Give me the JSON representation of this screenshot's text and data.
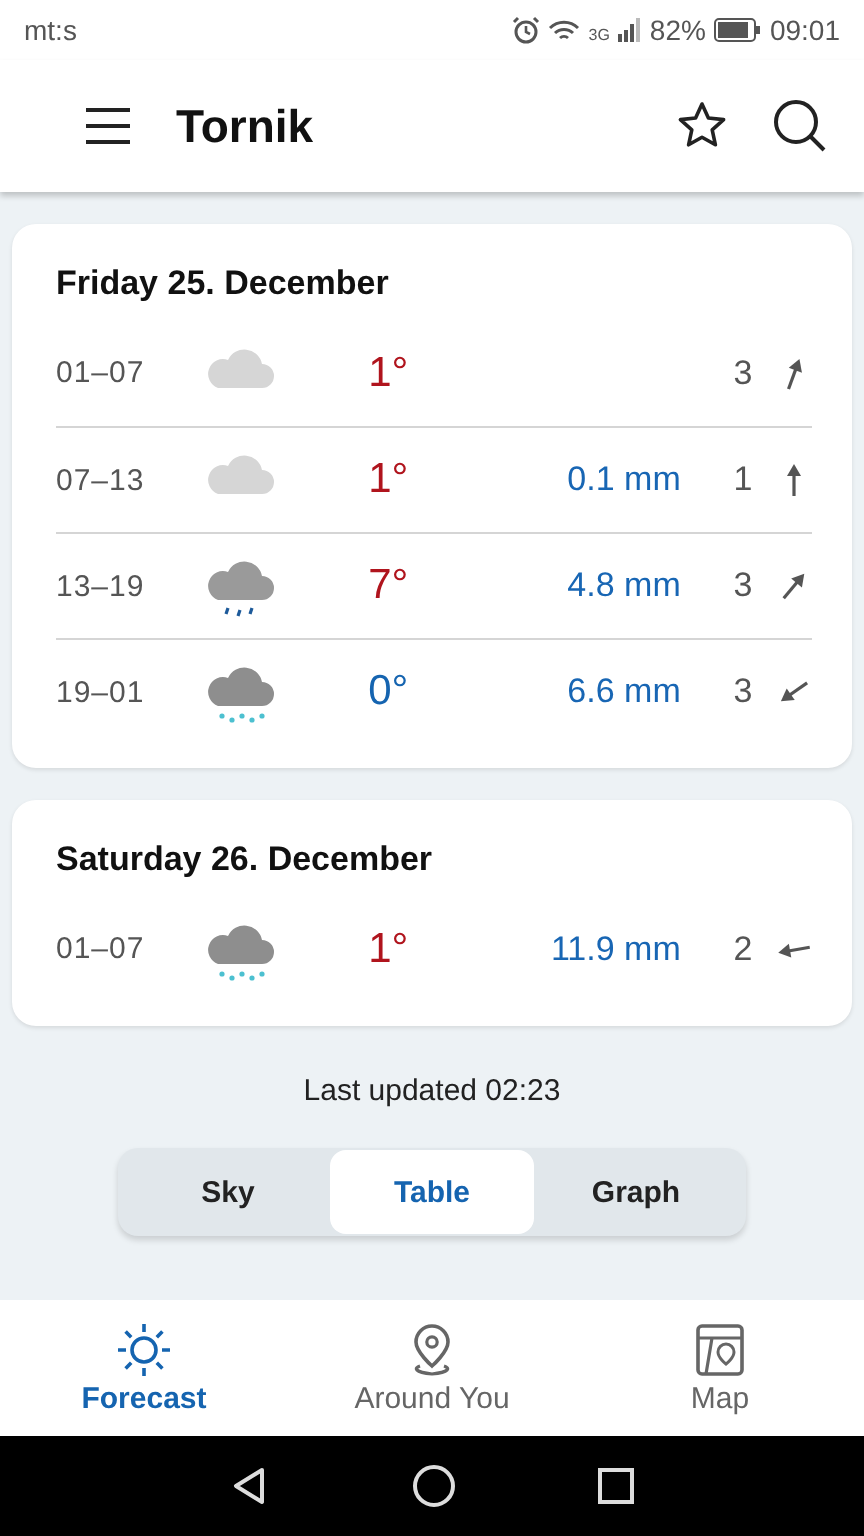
{
  "status_bar": {
    "carrier": "mt:s",
    "network": "3G",
    "battery": "82%",
    "time": "09:01"
  },
  "app_bar": {
    "title": "Tornik"
  },
  "days": [
    {
      "title": "Friday 25. December",
      "rows": [
        {
          "time": "01–07",
          "kind": "cloudy",
          "temp": "1°",
          "color": "#b0141d",
          "wind": "3",
          "arrow": {
            "kind": "nne"
          }
        },
        {
          "time": "07–13",
          "kind": "cloudy",
          "temp": "1°",
          "color": "#b0141d",
          "precip": "0.1 mm",
          "wind": "1",
          "arrow": {
            "kind": "n"
          }
        },
        {
          "time": "13–19",
          "kind": "rain",
          "temp": "7°",
          "color": "#b0141d",
          "precip": "4.8 mm",
          "wind": "3",
          "arrow": {
            "kind": "ne"
          }
        },
        {
          "time": "19–01",
          "kind": "snow",
          "temp": "0°",
          "color": "#1564b0",
          "precip": "6.6 mm",
          "wind": "3",
          "arrow": {
            "kind": "sw"
          }
        }
      ]
    },
    {
      "title": "Saturday 26. December",
      "rows": [
        {
          "time": "01–07",
          "kind": "snow",
          "temp": "1°",
          "color": "#b0141d",
          "precip": "11.9 mm",
          "wind": "2",
          "arrow": {
            "kind": "w"
          }
        }
      ]
    }
  ],
  "last_updated": "Last updated 02:23",
  "view_tabs": [
    {
      "label": "Sky",
      "selected": false
    },
    {
      "label": "Table",
      "selected": true
    },
    {
      "label": "Graph",
      "selected": false
    }
  ],
  "bottom_nav": [
    {
      "label": "Forecast",
      "kind": "forecast",
      "selected": true
    },
    {
      "label": "Around You",
      "kind": "around",
      "selected": false
    },
    {
      "label": "Map",
      "kind": "map",
      "selected": false
    }
  ]
}
